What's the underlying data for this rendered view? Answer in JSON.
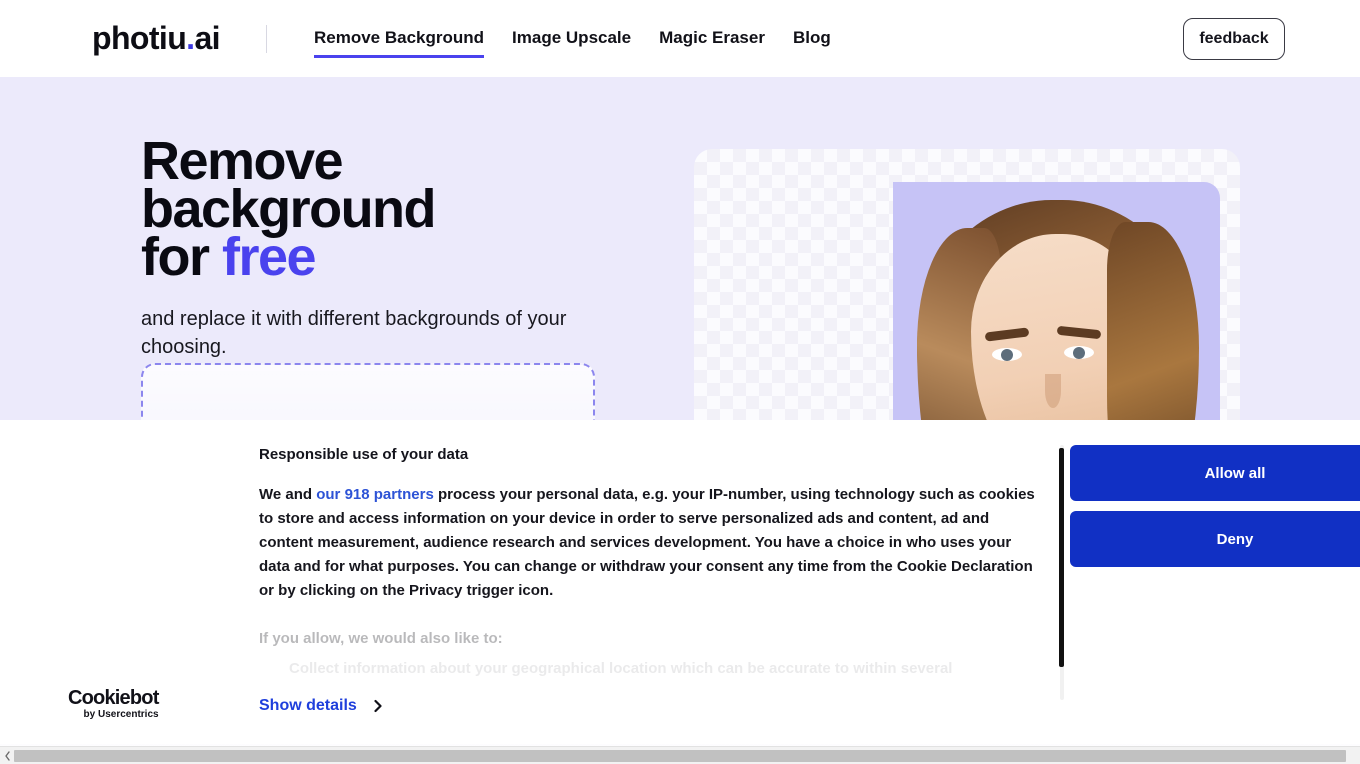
{
  "header": {
    "logo": {
      "text_before": "photiu",
      "dot1": ".",
      "text_after": "ai",
      "full": "photiu.ai"
    },
    "nav": [
      {
        "label": "Remove Background",
        "active": true
      },
      {
        "label": "Image Upscale",
        "active": false
      },
      {
        "label": "Magic Eraser",
        "active": false
      },
      {
        "label": "Blog",
        "active": false
      }
    ],
    "feedback_label": "feedback"
  },
  "hero": {
    "title_line1": "Remove",
    "title_line2": "background",
    "title_line3_prefix": "for ",
    "title_line3_accent": "free",
    "subtitle": "and replace it with different backgrounds of your choosing.",
    "upload_button_label": ""
  },
  "cookie_banner": {
    "heading": "Responsible use of your data",
    "body_prefix": "We and ",
    "partners_link": "our 918 partners",
    "body_suffix": " process your personal data, e.g. your IP-number, using technology such as cookies to store and access information on your device in order to serve personalized ads and content, ad and content measurement, audience research and services development. You have a choice in who uses your data and for what purposes. You can change or withdraw your consent any time from the Cookie Declaration or by clicking on the Privacy trigger icon.",
    "subhead": "If you allow, we would also like to:",
    "faded_item": "Collect information about your geographical location which can be accurate to within several",
    "allow_all_label": "Allow all",
    "deny_label": "Deny",
    "show_details_label": "Show details",
    "brand_main": "Cookiebot",
    "brand_sub": "by Usercentrics"
  },
  "colors": {
    "accent_indigo": "#4a42ee",
    "upload_button": "#4036e6",
    "cookie_button": "#1130c4",
    "link_blue": "#2d53d6",
    "hero_background": "#eceafb",
    "portrait_panel": "#c6c3f6"
  },
  "icons": {
    "chevron_right": "chevron-right-icon",
    "scrollbar_left_arrow": "chevron-left-icon"
  }
}
